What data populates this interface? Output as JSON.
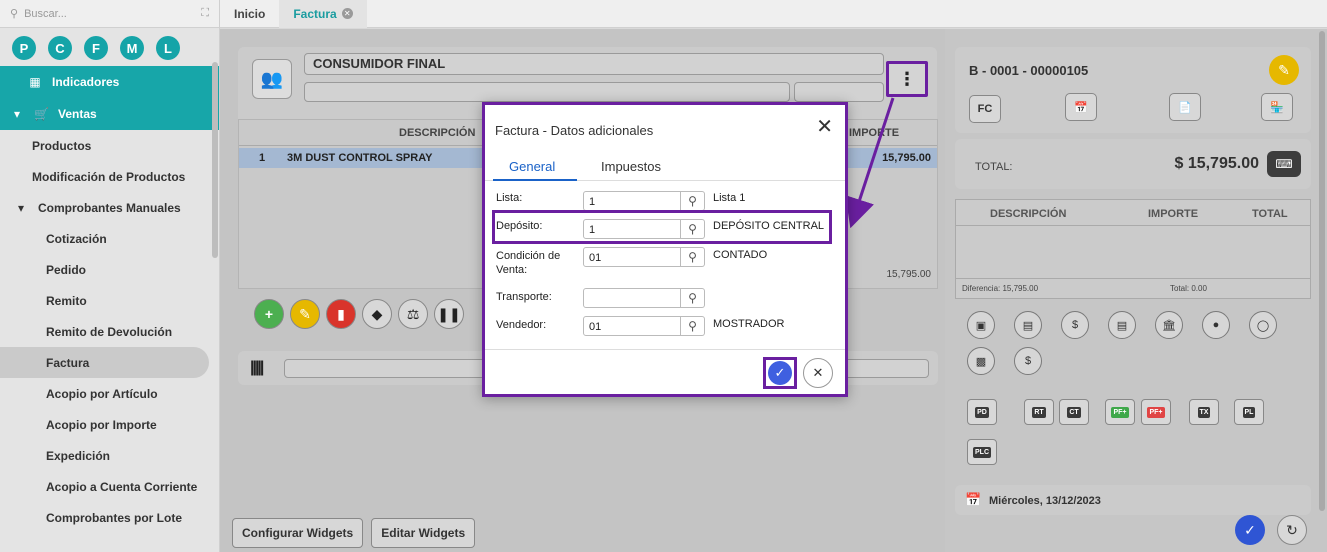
{
  "sidebar": {
    "search_placeholder": "Buscar...",
    "shortcuts": [
      "P",
      "C",
      "F",
      "M",
      "L"
    ],
    "teal_items": [
      {
        "label": "Indicadores",
        "icon": "grid-icon"
      },
      {
        "label": "Ventas",
        "icon": "cart-icon"
      }
    ],
    "items": [
      {
        "label": "Productos",
        "level": 1
      },
      {
        "label": "Modificación de Productos",
        "level": 1
      },
      {
        "label": "Comprobantes Manuales",
        "level": 1
      },
      {
        "label": "Cotización",
        "level": 2
      },
      {
        "label": "Pedido",
        "level": 2
      },
      {
        "label": "Remito",
        "level": 2
      },
      {
        "label": "Remito de Devolución",
        "level": 2
      },
      {
        "label": "Factura",
        "level": 2
      },
      {
        "label": "Acopio por Artículo",
        "level": 2
      },
      {
        "label": "Acopio por Importe",
        "level": 2
      },
      {
        "label": "Expedición",
        "level": 2
      },
      {
        "label": "Acopio a Cuenta Corriente",
        "level": 2
      },
      {
        "label": "Comprobantes por Lote",
        "level": 2
      }
    ]
  },
  "tabs": [
    {
      "label": "Inicio",
      "active": false
    },
    {
      "label": "Factura",
      "active": true
    }
  ],
  "customer": {
    "name": "CONSUMIDOR FINAL"
  },
  "grid": {
    "headers": {
      "description": "DESCRIPCIÓN",
      "amount": "IMPORTE"
    },
    "rows": [
      {
        "num": "1",
        "description": "3M DUST CONTROL SPRAY",
        "amount": "15,795.00"
      }
    ],
    "total": "15,795.00"
  },
  "buttons": {
    "configure_widgets": "Configurar Widgets",
    "edit_widgets": "Editar Widgets"
  },
  "invoice": {
    "number": "B - 0001 - 00000105",
    "type_code": "FC",
    "total_label": "TOTAL:",
    "total_value": "$ 15,795.00",
    "payments_headers": [
      "DESCRIPCIÓN",
      "IMPORTE",
      "TOTAL"
    ],
    "difference": "Diferencia: 15,795.00",
    "paid_total": "Total: 0.00",
    "doc_codes": [
      "PD",
      "RT",
      "CT",
      "PF+",
      "PF+",
      "TX",
      "PL",
      "PLC"
    ],
    "date": "Miércoles, 13/12/2023"
  },
  "modal": {
    "title": "Factura - Datos adicionales",
    "tabs": [
      "General",
      "Impuestos"
    ],
    "fields": [
      {
        "label": "Lista:",
        "value": "1",
        "desc": "Lista 1"
      },
      {
        "label": "Depósito:",
        "value": "1",
        "desc": "DEPÓSITO CENTRAL"
      },
      {
        "label": "Condición de Venta:",
        "value": "01",
        "desc": "CONTADO"
      },
      {
        "label": "Transporte:",
        "value": "",
        "desc": ""
      },
      {
        "label": "Vendedor:",
        "value": "01",
        "desc": "MOSTRADOR"
      }
    ]
  },
  "colors": {
    "accent": "#17a6a9",
    "highlight": "#6a1fa0",
    "primary": "#3f5fe0"
  }
}
